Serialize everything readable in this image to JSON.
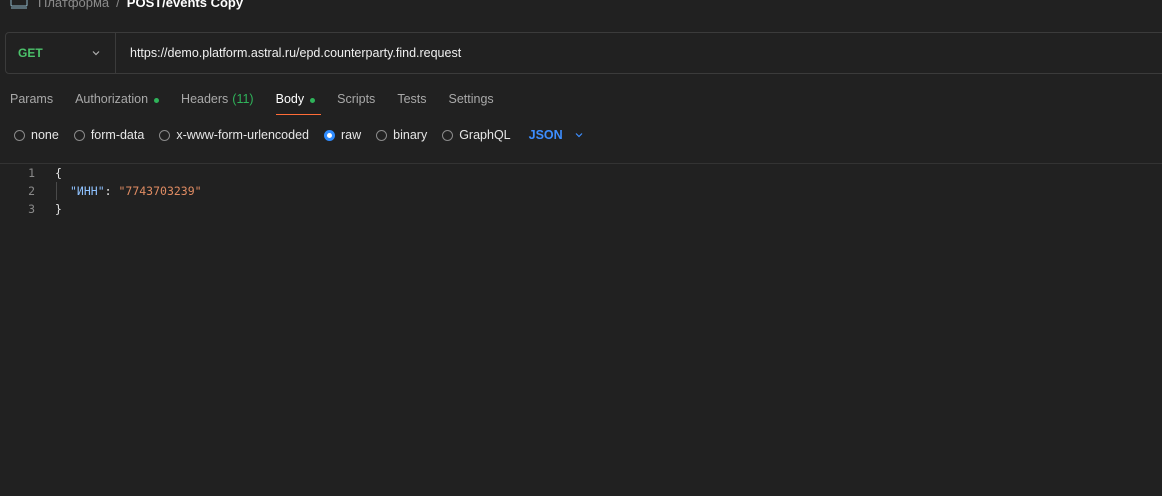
{
  "breadcrumb": {
    "icon": "http-request-icon",
    "parent": "Платформа",
    "separator": "/",
    "current": "POST/events Copy"
  },
  "request": {
    "method": "GET",
    "url": "https://demo.platform.astral.ru/epd.counterparty.find.request"
  },
  "tabs": [
    {
      "label": "Params",
      "active": false
    },
    {
      "label": "Authorization",
      "active": false,
      "dot": true
    },
    {
      "label": "Headers",
      "count": "(11)",
      "active": false
    },
    {
      "label": "Body",
      "active": true,
      "dot": true
    },
    {
      "label": "Scripts",
      "active": false
    },
    {
      "label": "Tests",
      "active": false
    },
    {
      "label": "Settings",
      "active": false
    }
  ],
  "body_types": [
    {
      "label": "none",
      "checked": false
    },
    {
      "label": "form-data",
      "checked": false
    },
    {
      "label": "x-www-form-urlencoded",
      "checked": false
    },
    {
      "label": "raw",
      "checked": true
    },
    {
      "label": "binary",
      "checked": false
    },
    {
      "label": "GraphQL",
      "checked": false
    }
  ],
  "raw_language": "JSON",
  "editor": {
    "line_numbers": [
      "1",
      "2",
      "3"
    ],
    "open_brace": "{",
    "key": "\"ИНН\"",
    "colon": ": ",
    "value": "\"7743703239\"",
    "close_brace": "}"
  },
  "colors": {
    "method_get": "#4cc26b",
    "active_tab_underline": "#ff6c37",
    "status_dot": "#2fb35a",
    "accent_blue": "#3d8eff",
    "json_key": "#8fc2ff",
    "json_string": "#e08c63"
  }
}
